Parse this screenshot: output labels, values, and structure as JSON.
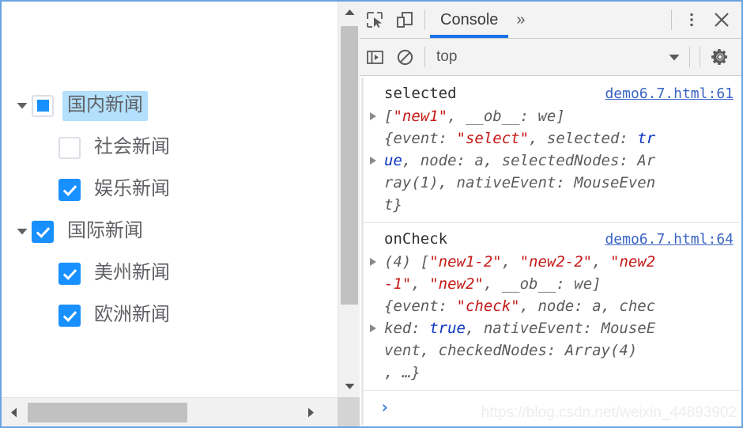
{
  "tree": {
    "nodes": [
      {
        "label": "国内新闻",
        "state": "indeterminate",
        "level": 0,
        "expandable": true,
        "selected": true
      },
      {
        "label": "社会新闻",
        "state": "unchecked",
        "level": 1,
        "expandable": false,
        "selected": false
      },
      {
        "label": "娱乐新闻",
        "state": "checked",
        "level": 1,
        "expandable": false,
        "selected": false
      },
      {
        "label": "国际新闻",
        "state": "checked",
        "level": 0,
        "expandable": true,
        "selected": false
      },
      {
        "label": "美州新闻",
        "state": "checked",
        "level": 1,
        "expandable": false,
        "selected": false
      },
      {
        "label": "欧洲新闻",
        "state": "checked",
        "level": 1,
        "expandable": false,
        "selected": false
      }
    ]
  },
  "devtools": {
    "toolbar": {
      "inspect_icon": "inspect-element-icon",
      "device_toolbar_icon": "device-toolbar-icon",
      "tabs": [
        {
          "label": "Console",
          "active": true
        }
      ],
      "more_tabs_label": "»",
      "kebab_icon": "more-options-icon",
      "close_icon": "close-icon"
    },
    "subbar": {
      "sidebar_icon": "console-sidebar-icon",
      "clear_icon": "clear-console-icon",
      "context_value": "top",
      "context_caret_icon": "chevron-down-icon",
      "settings_icon": "gear-icon"
    },
    "console": {
      "entries": [
        {
          "title": "selected",
          "source": "demo6.7.html:61",
          "lines": [
            {
              "triangle": true,
              "parts": [
                {
                  "t": "[",
                  "c": "plain"
                },
                {
                  "t": "\"new1\"",
                  "c": "str"
                },
                {
                  "t": ", __ob__: we]",
                  "c": "plain"
                }
              ]
            },
            {
              "triangle": false,
              "parts": [
                {
                  "t": "{event: ",
                  "c": "plain"
                },
                {
                  "t": "\"select\"",
                  "c": "str"
                },
                {
                  "t": ", selected: ",
                  "c": "plain"
                },
                {
                  "t": "tr",
                  "c": "kw"
                }
              ]
            },
            {
              "triangle": true,
              "parts": [
                {
                  "t": "ue",
                  "c": "kw"
                },
                {
                  "t": ", node: a, selectedNodes: Ar",
                  "c": "plain"
                }
              ]
            },
            {
              "triangle": false,
              "parts": [
                {
                  "t": "ray(1), nativeEvent: MouseEven",
                  "c": "plain"
                }
              ]
            },
            {
              "triangle": false,
              "parts": [
                {
                  "t": "t}",
                  "c": "plain"
                }
              ]
            }
          ]
        },
        {
          "title": "onCheck",
          "source": "demo6.7.html:64",
          "lines": [
            {
              "triangle": true,
              "parts": [
                {
                  "t": "(4) [",
                  "c": "plain"
                },
                {
                  "t": "\"new1-2\"",
                  "c": "str"
                },
                {
                  "t": ", ",
                  "c": "plain"
                },
                {
                  "t": "\"new2-2\"",
                  "c": "str"
                },
                {
                  "t": ", ",
                  "c": "plain"
                },
                {
                  "t": "\"new2",
                  "c": "str"
                }
              ]
            },
            {
              "triangle": false,
              "parts": [
                {
                  "t": "-1\"",
                  "c": "str"
                },
                {
                  "t": ", ",
                  "c": "plain"
                },
                {
                  "t": "\"new2\"",
                  "c": "str"
                },
                {
                  "t": ", __ob__: we]",
                  "c": "plain"
                }
              ]
            },
            {
              "triangle": false,
              "parts": [
                {
                  "t": "{event: ",
                  "c": "plain"
                },
                {
                  "t": "\"check\"",
                  "c": "str"
                },
                {
                  "t": ", node: a, chec",
                  "c": "plain"
                }
              ]
            },
            {
              "triangle": true,
              "parts": [
                {
                  "t": "ked: ",
                  "c": "plain"
                },
                {
                  "t": "true",
                  "c": "kw"
                },
                {
                  "t": ", nativeEvent: MouseE",
                  "c": "plain"
                }
              ]
            },
            {
              "triangle": false,
              "parts": [
                {
                  "t": "vent, checkedNodes: Array(4)",
                  "c": "plain"
                }
              ]
            },
            {
              "triangle": false,
              "parts": [
                {
                  "t": ", …}",
                  "c": "plain"
                }
              ]
            }
          ]
        }
      ],
      "prompt_symbol": "›",
      "watermark": "https://blog.csdn.net/weixin_44893902"
    }
  },
  "colors": {
    "accent_blue": "#1890ff",
    "selection_blue": "#b3e0fc",
    "tab_underline": "#1a73e8",
    "string_red": "#c41a16",
    "keyword_blue": "#0b35c4",
    "link_blue": "#3a65c4",
    "window_border": "#6aa4de"
  }
}
